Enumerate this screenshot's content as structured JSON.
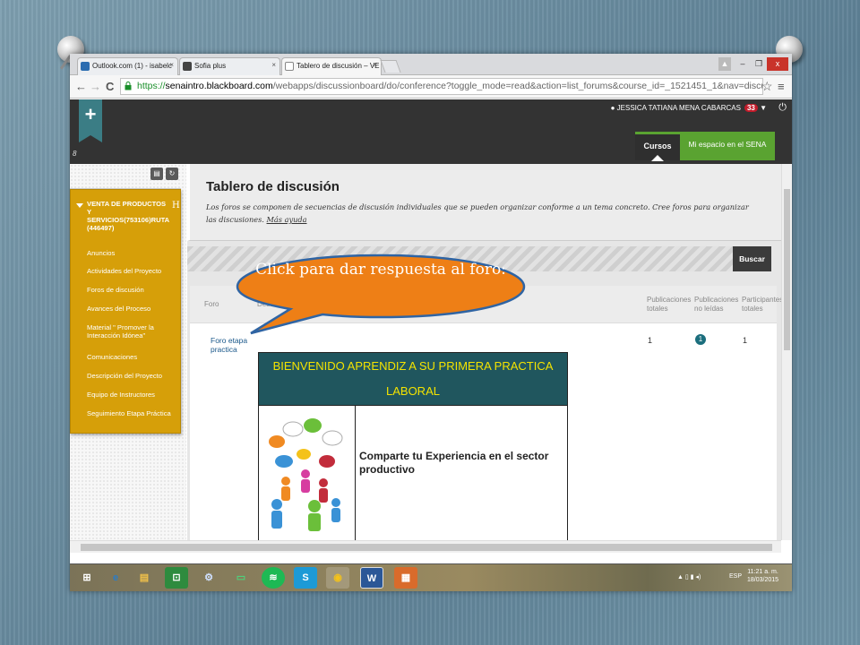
{
  "browser": {
    "tabs": [
      {
        "label": "Outlook.com (1) - isabelc",
        "close": "×",
        "color": "#2b6cb0"
      },
      {
        "label": "Sofia plus",
        "close": "×",
        "color": "#444444"
      },
      {
        "label": "Tablero de discusión – VE",
        "close": "×",
        "color": "#888888"
      }
    ],
    "window_buttons": {
      "user": "▲",
      "minimize": "–",
      "restore": "❐",
      "close": "x"
    },
    "url": {
      "scheme": "https://",
      "host": "senaintro.blackboard.com",
      "path": "/webapps/discussionboard/do/conference?toggle_mode=read&action=list_forums&course_id=_1521451_1&nav=discussion_board_ent"
    },
    "nav": {
      "back": "←",
      "forward": "→",
      "reload": "C",
      "star": "☆",
      "menu": "≡"
    }
  },
  "header": {
    "plus": "+",
    "user_name": "JESSICA TATIANA MENA CABARCAS",
    "badge": "33",
    "caret": "▼",
    "power": "⏻",
    "tab_courses": "Cursos",
    "tab_myspace": "Mi espacio en el SENA",
    "corner_mark": "8"
  },
  "sidebar": {
    "tool_buttons": [
      "▤",
      "↻"
    ],
    "course_title": "VENTA DE PRODUCTOS Y SERVICIOS(753106)RUTA (446497)",
    "course_marker": "H",
    "items": [
      "Anuncios",
      "Actividades del Proyecto",
      "Foros de discusión",
      "Avances del Proceso",
      "Material \" Promover la Interacción Idónea\"",
      "Comunicaciones",
      "Descripción del Proyecto",
      "Equipo de Instructores",
      "Seguimiento Etapa Práctica"
    ]
  },
  "main": {
    "title": "Tablero de discusión",
    "description": "Los foros se componen de secuencias de discusión individuales que se pueden organizar conforme a un tema concreto. Cree foros para organizar las discusiones.",
    "more_help": "Más ayuda",
    "search_button": "Buscar",
    "columns": {
      "forum": "Foro",
      "description": "Descripción",
      "total_posts": "Publicaciones totales",
      "unread_posts": "Publicaciones no leídas",
      "participants": "Participantes totales"
    },
    "rows": [
      {
        "forum": "Foro etapa practica",
        "total_posts": "1",
        "unread_posts": "1",
        "participants": "1"
      }
    ],
    "welcome": {
      "heading": "BIENVENIDO APRENDIZ A SU PRIMERA PRACTICA LABORAL",
      "body": "Comparte tu Experiencia en el sector productivo"
    }
  },
  "callout": {
    "text": "Click para dar respuesta al foro:",
    "fill": "#ee7f16",
    "stroke": "#2f64a3"
  },
  "taskbar": {
    "items": [
      {
        "name": "windows-start",
        "glyph": "⊞",
        "color": "#3a6ea5"
      },
      {
        "name": "internet-explorer",
        "glyph": "e",
        "color": "#2a7cc7"
      },
      {
        "name": "file-explorer",
        "glyph": "▤",
        "color": "#d9a630"
      },
      {
        "name": "store",
        "glyph": "⊡",
        "color": "#2e8b3e"
      },
      {
        "name": "control-panel",
        "glyph": "⚙",
        "color": "#4a7fc2"
      },
      {
        "name": "green-app",
        "glyph": "▭",
        "color": "#3e9d5a"
      },
      {
        "name": "spotify",
        "glyph": "≋",
        "color": "#1db954"
      },
      {
        "name": "skype",
        "glyph": "S",
        "color": "#1d9ad6"
      },
      {
        "name": "chrome",
        "glyph": "◉",
        "color": "#d9443a"
      },
      {
        "name": "word",
        "glyph": "W",
        "color": "#2b5797"
      },
      {
        "name": "media-app",
        "glyph": "▦",
        "color": "#d96b2b"
      }
    ],
    "tray_language": "ESP",
    "time": "11:21 a. m.",
    "date": "18/03/2015"
  }
}
